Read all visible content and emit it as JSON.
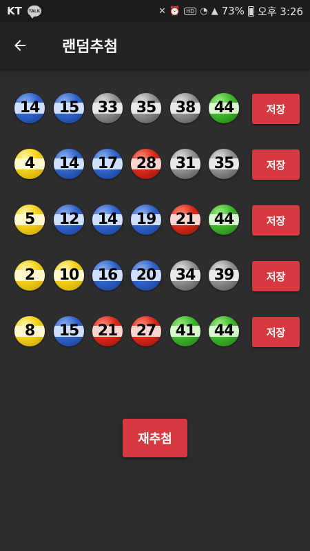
{
  "status_bar": {
    "carrier": "KT",
    "talk_badge": "TALK",
    "battery": "73%",
    "time": "오후 3:26"
  },
  "app_bar": {
    "title": "랜덤추첨",
    "back_icon": "arrow-left-icon"
  },
  "colors": {
    "yellow": "#f3d51e",
    "blue": "#2f62c8",
    "red": "#d8291a",
    "gray": "#8f8f8f",
    "green": "#3fb62b",
    "button": "#d63a40"
  },
  "rows": [
    {
      "numbers": [
        "14",
        "15",
        "33",
        "35",
        "38",
        "44"
      ],
      "save_label": "저장"
    },
    {
      "numbers": [
        "4",
        "14",
        "17",
        "28",
        "31",
        "35"
      ],
      "save_label": "저장"
    },
    {
      "numbers": [
        "5",
        "12",
        "14",
        "19",
        "21",
        "44"
      ],
      "save_label": "저장"
    },
    {
      "numbers": [
        "2",
        "10",
        "16",
        "20",
        "34",
        "39"
      ],
      "save_label": "저장"
    },
    {
      "numbers": [
        "8",
        "15",
        "21",
        "27",
        "41",
        "44"
      ],
      "save_label": "저장"
    }
  ],
  "redraw_label": "재추첨"
}
